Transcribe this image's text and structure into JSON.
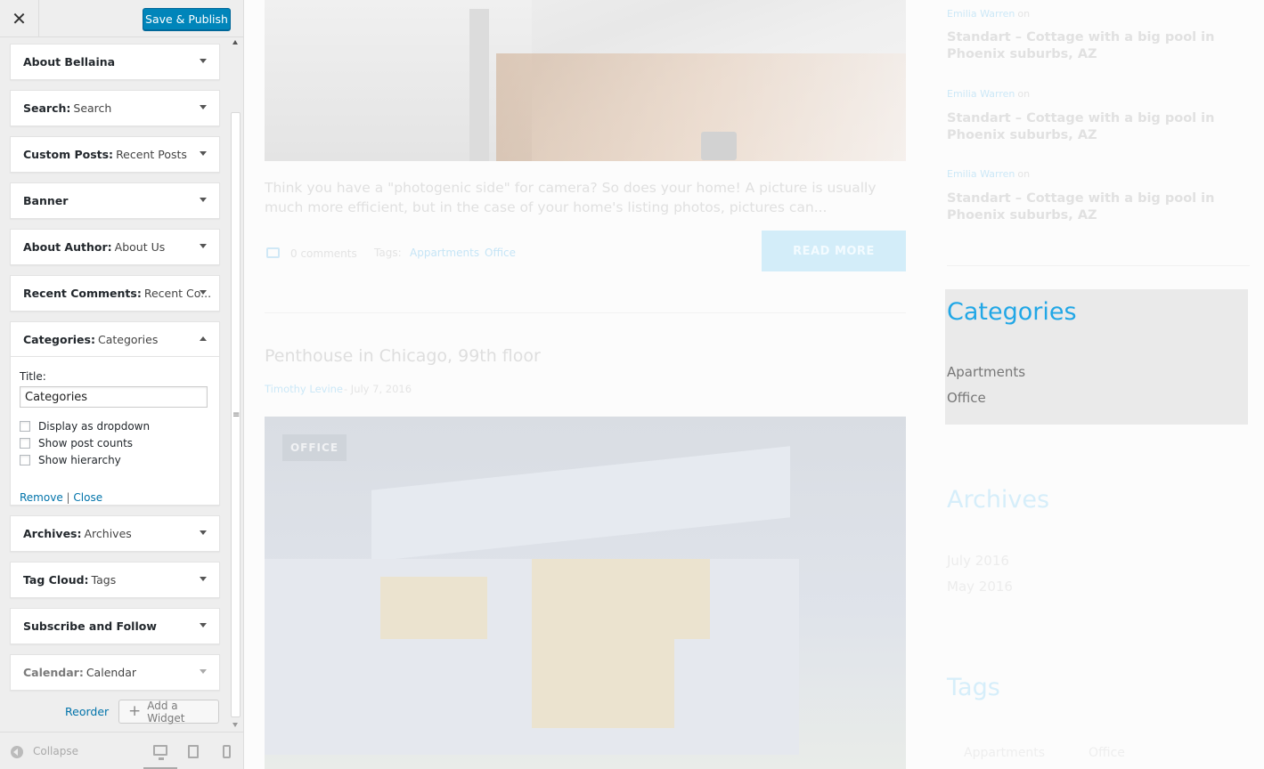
{
  "header": {
    "close_icon": "✕",
    "publish_label": "Save & Publish"
  },
  "widgets": [
    {
      "name": "About Bellaina",
      "sub": ""
    },
    {
      "name": "Search:",
      "sub": "Search"
    },
    {
      "name": "Custom Posts:",
      "sub": "Recent Posts"
    },
    {
      "name": "Banner",
      "sub": ""
    },
    {
      "name": "About Author:",
      "sub": "About Us"
    },
    {
      "name": "Recent Comments:",
      "sub": "Recent Co..."
    },
    {
      "name": "Categories:",
      "sub": "Categories"
    },
    {
      "name": "Archives:",
      "sub": "Archives"
    },
    {
      "name": "Tag Cloud:",
      "sub": "Tags"
    },
    {
      "name": "Subscribe and Follow",
      "sub": ""
    },
    {
      "name": "Calendar:",
      "sub": "Calendar"
    }
  ],
  "categories_form": {
    "title_label": "Title:",
    "title_value": "Categories",
    "options": [
      "Display as dropdown",
      "Show post counts",
      "Show hierarchy"
    ],
    "remove_label": "Remove",
    "separator": "|",
    "close_label": "Close"
  },
  "actions": {
    "reorder_label": "Reorder",
    "add_widget_label": "Add a Widget"
  },
  "footer": {
    "collapse_label": "Collapse"
  },
  "preview": {
    "excerpt": "Think you have a \"photogenic side\" for camera? So does your home! A picture is usually much more efficient, but in the case of your home's listing photos, pictures can...",
    "comments": "0 comments",
    "tags_label": "Tags:",
    "tags": [
      "Appartments",
      "Office"
    ],
    "read_more": "READ MORE",
    "post2": {
      "title": "Penthouse in Chicago, 99th floor",
      "author": "Timothy Levine",
      "date": "- July 7, 2016",
      "badge": "OFFICE"
    },
    "recent_posts": [
      {
        "author": "Emilia Warren",
        "on": "on",
        "title": "Standart – Cottage with a big pool in Phoenix suburbs, AZ"
      },
      {
        "author": "Emilia Warren",
        "on": "on",
        "title": "Standart – Cottage with a big pool in Phoenix suburbs, AZ"
      },
      {
        "author": "Emilia Warren",
        "on": "on",
        "title": "Standart – Cottage with a big pool in Phoenix suburbs, AZ"
      }
    ],
    "categories": {
      "heading": "Categories",
      "items": [
        "Apartments",
        "Office"
      ]
    },
    "archives": {
      "heading": "Archives",
      "items": [
        "July 2016",
        "May 2016"
      ]
    },
    "tags_widget": {
      "heading": "Tags",
      "items": [
        "Appartments",
        "Office"
      ]
    }
  },
  "colors": {
    "accent": "#0085ba",
    "link": "#0073aa",
    "preview_accent": "#21a7e6"
  }
}
